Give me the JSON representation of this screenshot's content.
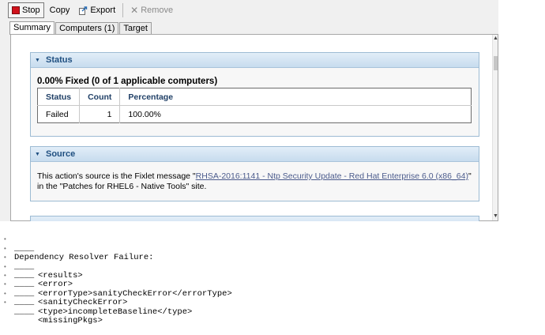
{
  "toolbar": {
    "stop_label": "Stop",
    "copy_label": "Copy",
    "export_label": "Export",
    "remove_label": "Remove"
  },
  "tabs": [
    {
      "label": "Summary",
      "active": true
    },
    {
      "label": "Computers (1)",
      "active": false
    },
    {
      "label": "Target",
      "active": false
    }
  ],
  "status": {
    "heading": "Status",
    "summary": "0.00% Fixed (0 of 1 applicable computers)",
    "columns": [
      "Status",
      "Count",
      "Percentage"
    ],
    "rows": [
      {
        "status": "Failed",
        "count": "1",
        "percentage": "100.00%"
      }
    ]
  },
  "source": {
    "heading": "Source",
    "text_before": "This action's source is the Fixlet message \"",
    "link": "RHSA-2016:1141 - Ntp Security Update - Red Hat Enterprise 6.0 (x86_64)",
    "text_after": "\" in the \"Patches for RHEL6 - Native Tools\" site."
  },
  "log": {
    "lead_blank": "____",
    "line_title": "Dependency Resolver Failure:",
    "lines": [
      {
        "lead": "____",
        "text": "<results>"
      },
      {
        "lead": "____",
        "text": "<error>"
      },
      {
        "lead": "____",
        "text": "<errorType>sanityCheckError</errorType>"
      },
      {
        "lead": "____",
        "text": "<sanityCheckError>"
      },
      {
        "lead": "____",
        "text": "<type>incompleteBaseline</type>"
      },
      {
        "lead": "____",
        "text": "<missingPkgs>"
      }
    ]
  },
  "colors": {
    "section_header_text": "#1f4f80",
    "section_border": "#9dbbd3",
    "stop_icon": "#d0121b",
    "link": "#4b5b8c"
  },
  "icons": [
    "stop-icon",
    "export-icon",
    "remove-icon",
    "collapse-triangle-icon"
  ]
}
